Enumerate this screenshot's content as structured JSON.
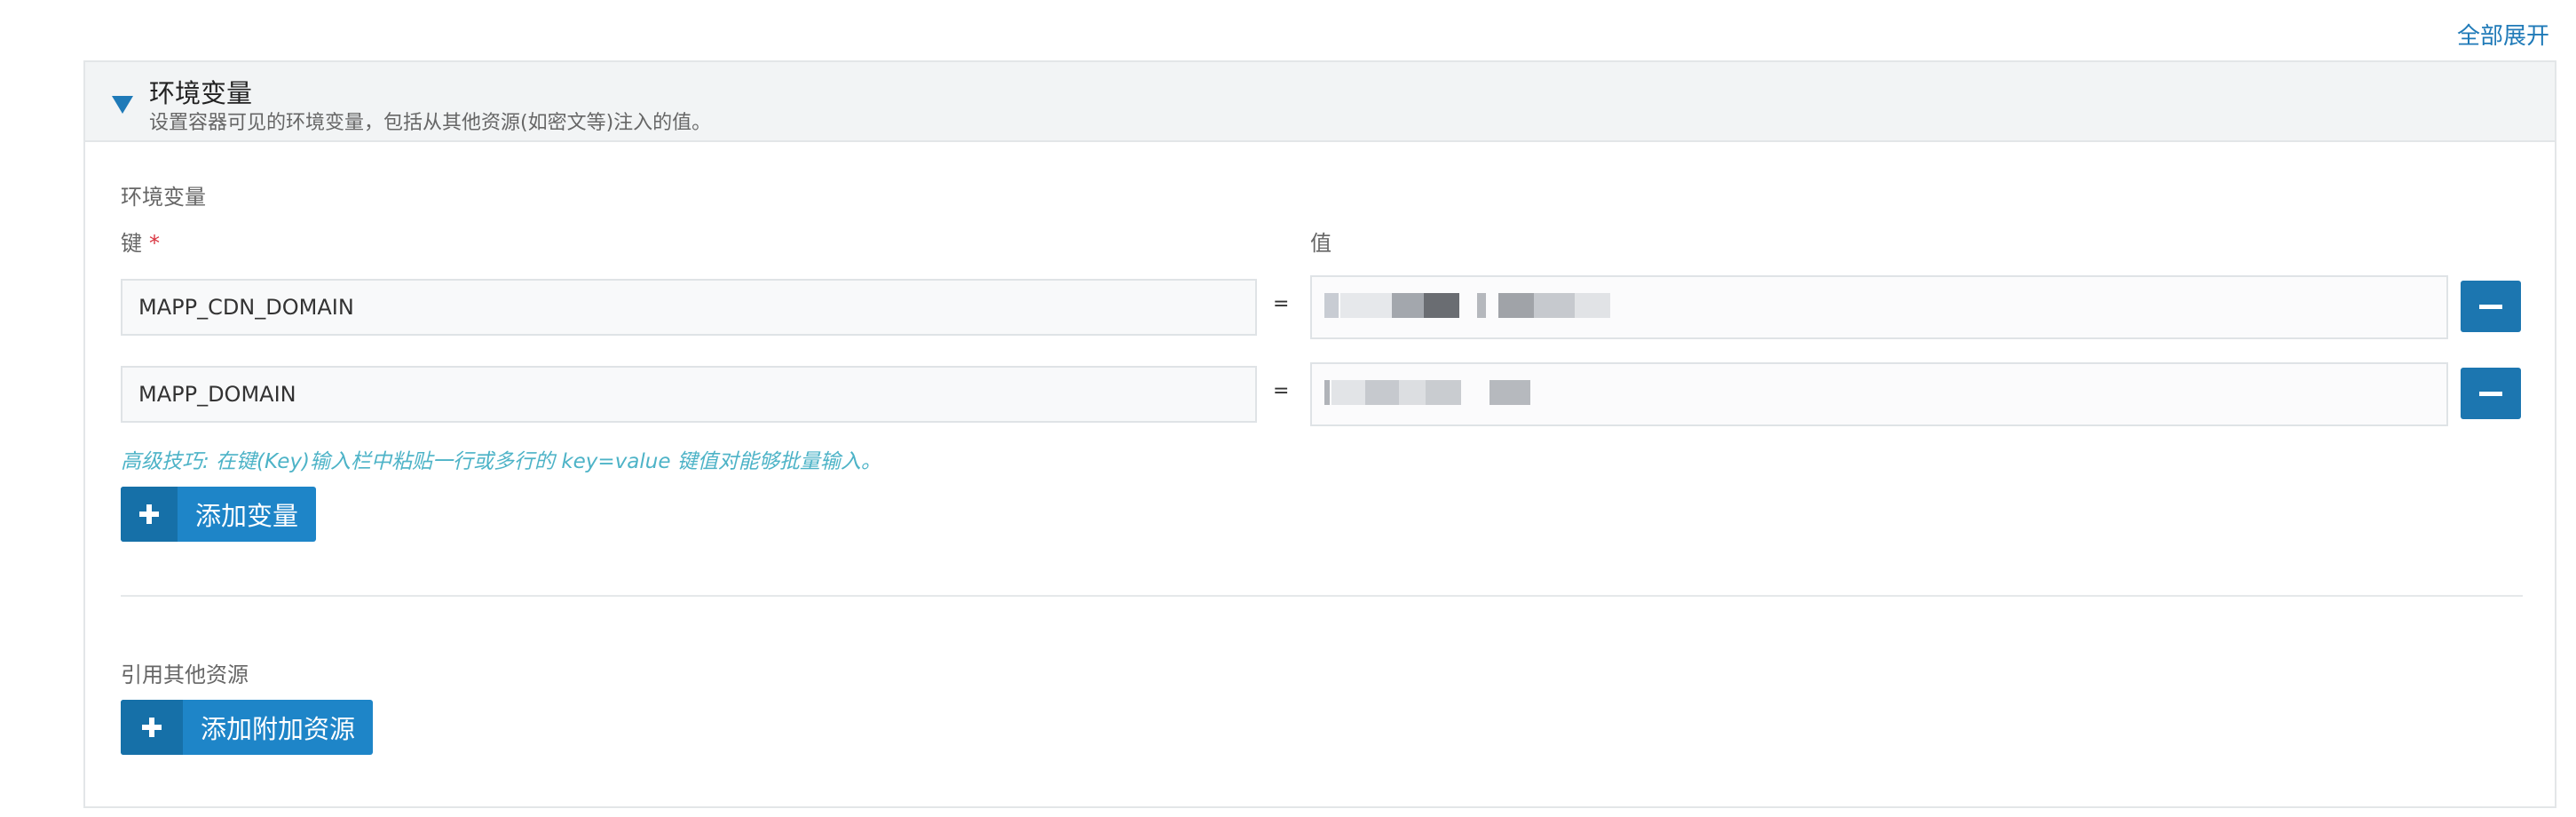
{
  "top": {
    "expand_all": "全部展开"
  },
  "panel": {
    "title": "环境变量",
    "description": "设置容器可见的环境变量，包括从其他资源(如密文等)注入的值。"
  },
  "env": {
    "section_label": "环境变量",
    "key_label": "键",
    "required_mark": "*",
    "value_label": "值",
    "equals": "=",
    "rows": [
      {
        "key": "MAPP_CDN_DOMAIN"
      },
      {
        "key": "MAPP_DOMAIN"
      }
    ],
    "tip": "高级技巧: 在键(Key)输入栏中粘贴一行或多行的 key=value 键值对能够批量输入。",
    "add_button": "添加变量"
  },
  "refs": {
    "section_label": "引用其他资源",
    "add_button": "添加附加资源"
  },
  "colors": {
    "accent": "#1f7ab8",
    "button": "#1e85c8",
    "tip": "#4db3c7",
    "required": "#d9333f"
  }
}
